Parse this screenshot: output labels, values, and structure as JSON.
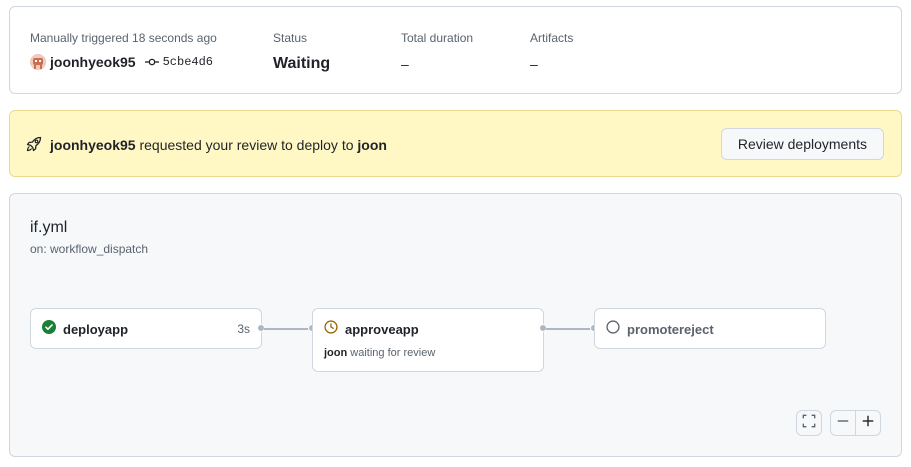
{
  "summary": {
    "trigger_label": "Manually triggered 18 seconds ago",
    "actor": "joonhyeok95",
    "commit_sha": "5cbe4d6",
    "status_label": "Status",
    "status_value": "Waiting",
    "duration_label": "Total duration",
    "duration_value": "–",
    "artifacts_label": "Artifacts",
    "artifacts_value": "–"
  },
  "banner": {
    "requester": "joonhyeok95",
    "text_middle": "requested your review to deploy to",
    "environment": "joon",
    "button_label": "Review deployments"
  },
  "workflow": {
    "name": "if.yml",
    "trigger": "on: workflow_dispatch",
    "jobs": [
      {
        "name": "deployapp",
        "status": "success",
        "duration": "3s"
      },
      {
        "name": "approveapp",
        "status": "waiting",
        "reviewer": "joon",
        "note": "waiting for review"
      },
      {
        "name": "promotereject",
        "status": "pending"
      }
    ]
  },
  "colors": {
    "success": "#1a7f37",
    "waiting": "#9a6700",
    "pending": "#59636e",
    "banner_bg": "#fff8c5"
  },
  "icons": [
    "avatar",
    "git-commit-icon",
    "rocket-icon",
    "check-circle-icon",
    "clock-icon",
    "circle-icon",
    "fullscreen-icon",
    "zoom-out-icon",
    "zoom-in-icon"
  ]
}
